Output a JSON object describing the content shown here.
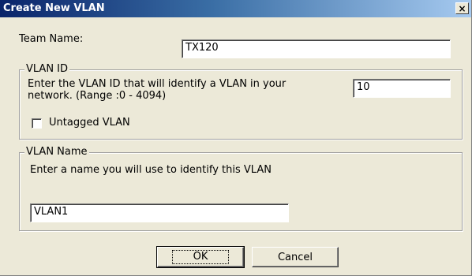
{
  "window": {
    "title": "Create New VLAN",
    "close_glyph": "×"
  },
  "team": {
    "label": "Team Name:",
    "value": "TX120"
  },
  "vlan_id": {
    "group_label": "VLAN ID",
    "description_line1": "Enter the VLAN ID that will identify a VLAN in your",
    "description_line2": "network. (Range :0 - 4094)",
    "value": "10",
    "untagged_label": "Untagged VLAN",
    "untagged_checked": false
  },
  "vlan_name": {
    "group_label": "VLAN Name",
    "description": "Enter a name you will use to identify this VLAN",
    "value": "VLAN1"
  },
  "buttons": {
    "ok": "OK",
    "cancel": "Cancel"
  }
}
